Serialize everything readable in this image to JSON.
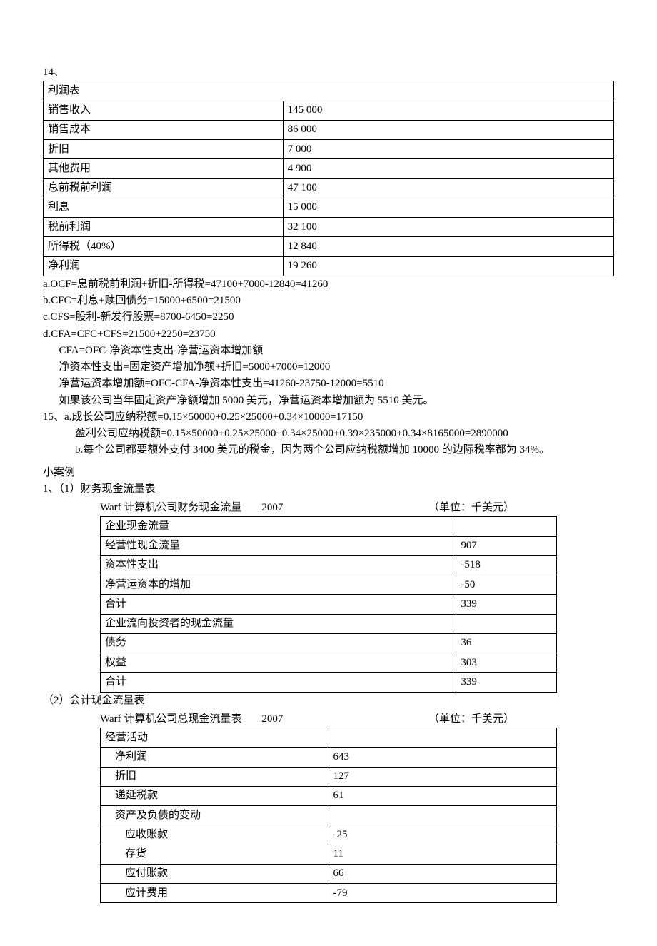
{
  "q14_label": "14、",
  "income_statement": {
    "title": "利润表",
    "rows": [
      {
        "label": "销售收入",
        "value": "145 000"
      },
      {
        "label": "销售成本",
        "value": "86 000"
      },
      {
        "label": "折旧",
        "value": "7 000"
      },
      {
        "label": "其他费用",
        "value": "4 900"
      },
      {
        "label": "息前税前利润",
        "value": "47 100"
      },
      {
        "label": "利息",
        "value": "15 000"
      },
      {
        "label": "税前利润",
        "value": "32 100"
      },
      {
        "label": "所得税（40%）",
        "value": "12 840"
      },
      {
        "label": "净利润",
        "value": "19 260"
      }
    ]
  },
  "calc_lines": {
    "a": "a.OCF=息前税前利润+折旧-所得税=47100+7000-12840=41260",
    "b": "b.CFC=利息+赎回债务=15000+6500=21500",
    "c": "c.CFS=股利-新发行股票=8700-6450=2250",
    "d1": "d.CFA=CFC+CFS=21500+2250=23750",
    "d2": "CFA=OFC-净资本性支出-净营运资本增加额",
    "d3": "净资本性支出=固定资产增加净额+折旧=5000+7000=12000",
    "d4": "净营运资本增加额=OFC-CFA-净资本性支出=41260-23750-12000=5510",
    "d5": "如果该公司当年固定资产净额增加 5000 美元，净营运资本增加额为 5510 美元。"
  },
  "q15": {
    "a1": "15、a.成长公司应纳税额=0.15×50000+0.25×25000+0.34×10000=17150",
    "a2": "盈利公司应纳税额=0.15×50000+0.25×25000+0.34×25000+0.39×235000+0.34×8165000=2890000",
    "b": "b.每个公司都要额外支付 3400 美元的税金，因为两个公司应纳税额增加   10000 的边际税率都为 34%。"
  },
  "case_label": "小案例",
  "case1_label": "1、（1）财务现金流量表",
  "cf_table": {
    "caption_left": "Warf 计算机公司财务现金流量",
    "caption_year": "2007",
    "caption_right": "（单位：千美元）",
    "rows": [
      {
        "label": "企业现金流量",
        "value": ""
      },
      {
        "label": "经营性现金流量",
        "value": "907"
      },
      {
        "label": "资本性支出",
        "value": "-518"
      },
      {
        "label": "净营运资本的增加",
        "value": "-50"
      },
      {
        "label": "合计",
        "value": "339"
      },
      {
        "label": "企业流向投资者的现金流量",
        "value": ""
      },
      {
        "label": "债务",
        "value": "36"
      },
      {
        "label": "权益",
        "value": "303"
      },
      {
        "label": "合计",
        "value": "339"
      }
    ]
  },
  "case2_label": "（2）会计现金流量表",
  "op_table": {
    "caption_left": "Warf 计算机公司总现金流量表",
    "caption_year": "2007",
    "caption_right": "（单位：千美元）",
    "rows": [
      {
        "label": "经营活动",
        "value": "",
        "indent": 0
      },
      {
        "label": "净利润",
        "value": "643",
        "indent": 1
      },
      {
        "label": "折旧",
        "value": "127",
        "indent": 1
      },
      {
        "label": "递延税款",
        "value": "61",
        "indent": 1
      },
      {
        "label": "资产及负债的变动",
        "value": "",
        "indent": 1
      },
      {
        "label": "应收账款",
        "value": "-25",
        "indent": 2
      },
      {
        "label": "存货",
        "value": "11",
        "indent": 2
      },
      {
        "label": "应付账款",
        "value": "66",
        "indent": 2
      },
      {
        "label": "应计费用",
        "value": "-79",
        "indent": 2
      }
    ]
  }
}
